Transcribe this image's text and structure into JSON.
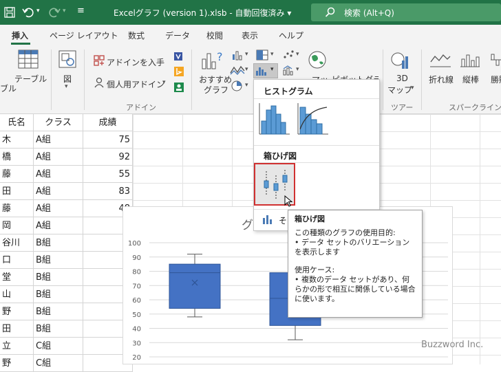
{
  "titlebar": {
    "filename": "Excelグラフ (version 1).xlsb",
    "autosave": "自動回復済み",
    "search_label": "検索 (Alt+Q)"
  },
  "tabs": [
    "挿入",
    "ページ レイアウト",
    "数式",
    "データ",
    "校閲",
    "表示",
    "ヘルプ"
  ],
  "ribbon": {
    "table_partial": "ブル",
    "table": "テーブル",
    "image": "図",
    "get_addins": "アドインを入手",
    "personal_addins": "個人用アドイン",
    "addin_group": "アドイン",
    "recommended_line1": "おすすめ",
    "recommended_line2": "グラフ",
    "map_partial": "マップ",
    "pivotchart_partial": "ピボットグラフ",
    "3dmap_line1": "3D",
    "3dmap_line2": "マップ",
    "tour_group": "ツアー",
    "line_spark": "折れ線",
    "column_spark": "縦棒",
    "winloss_partial": "勝敗",
    "sparkline_group": "スパークライン"
  },
  "sheet": {
    "headers": [
      "氏名",
      "クラス",
      "成績"
    ],
    "rows": [
      [
        "木",
        "A組",
        "75"
      ],
      [
        "橋",
        "A組",
        "92"
      ],
      [
        "藤",
        "A組",
        "55"
      ],
      [
        "田",
        "A組",
        "83"
      ],
      [
        "藤",
        "A組",
        "48"
      ],
      [
        "岡",
        "A組",
        ""
      ],
      [
        "谷川",
        "B組",
        ""
      ],
      [
        "口",
        "B組",
        ""
      ],
      [
        "堂",
        "B組",
        ""
      ],
      [
        "山",
        "B組",
        ""
      ],
      [
        "野",
        "B組",
        ""
      ],
      [
        "田",
        "B組",
        ""
      ],
      [
        "立",
        "C組",
        ""
      ],
      [
        "野",
        "C組",
        ""
      ]
    ]
  },
  "dropdown": {
    "histogram_header": "ヒストグラム",
    "boxplot_header": "箱ひげ図",
    "more_partial": "そ"
  },
  "tooltip": {
    "title": "箱ひげ図",
    "purpose_label": "この種類のグラフの使用目的:",
    "purpose_item": "• データ セットのバリエーションを表示します",
    "usecase_label": "使用ケース:",
    "usecase_item": "• 複数のデータ セットがあり、何らかの形で相互に関係している場合に使います。"
  },
  "chart_data": {
    "type": "box",
    "title_partial": "グ",
    "yticks": [
      "100",
      "90",
      "80",
      "70",
      "60",
      "50",
      "40",
      "30",
      "20"
    ],
    "ylim": [
      20,
      100
    ],
    "boxes": [
      {
        "min": 48,
        "q1": 54,
        "median": 79,
        "q3": 85,
        "max": 92,
        "mean": 72
      },
      {
        "min": 32,
        "q1": 42,
        "median": 61,
        "q3": 79,
        "max": 79
      }
    ],
    "box_color": "#4472c4"
  },
  "watermark": "Buzzword Inc."
}
